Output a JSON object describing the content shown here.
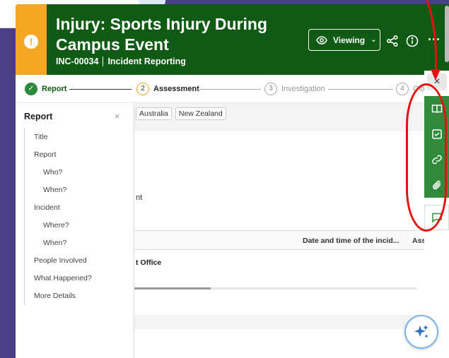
{
  "header": {
    "title": "Injury: Sports Injury During Campus Event",
    "incident_id": "INC-00034",
    "category": "Incident Reporting",
    "viewing_label": "Viewing",
    "more_label": "···",
    "colors": {
      "header_bg": "#0f5b14",
      "status_stripe": "#f5a623"
    }
  },
  "stepper": {
    "steps": [
      {
        "num": "✓",
        "label": "Report"
      },
      {
        "num": "2",
        "label": "Assessment"
      },
      {
        "num": "3",
        "label": "Investigation"
      },
      {
        "num": "4",
        "label": "Close Out"
      }
    ]
  },
  "sidenav": {
    "title": "Report",
    "close": "×",
    "items": [
      {
        "label": "Title",
        "level": 1
      },
      {
        "label": "Report",
        "level": 1
      },
      {
        "label": "Who?",
        "level": 2
      },
      {
        "label": "When?",
        "level": 2
      },
      {
        "label": "Incident",
        "level": 1
      },
      {
        "label": "Where?",
        "level": 2
      },
      {
        "label": "When?",
        "level": 2
      },
      {
        "label": "People Involved",
        "level": 1
      },
      {
        "label": "What Happened?",
        "level": 1
      },
      {
        "label": "More Details",
        "level": 1
      }
    ]
  },
  "main": {
    "chips": [
      "Australia",
      "New Zealand"
    ],
    "text_fragment": "nt",
    "table": {
      "headers": [
        "Date and time of the incid...",
        "Assignee"
      ],
      "row_cell": "t Office"
    }
  },
  "rail": {
    "close": "×",
    "buttons": [
      "book-icon",
      "checkbox-icon",
      "link-icon",
      "paperclip-icon",
      "comment-icon"
    ]
  },
  "annotation": {
    "color": "#e81111"
  }
}
